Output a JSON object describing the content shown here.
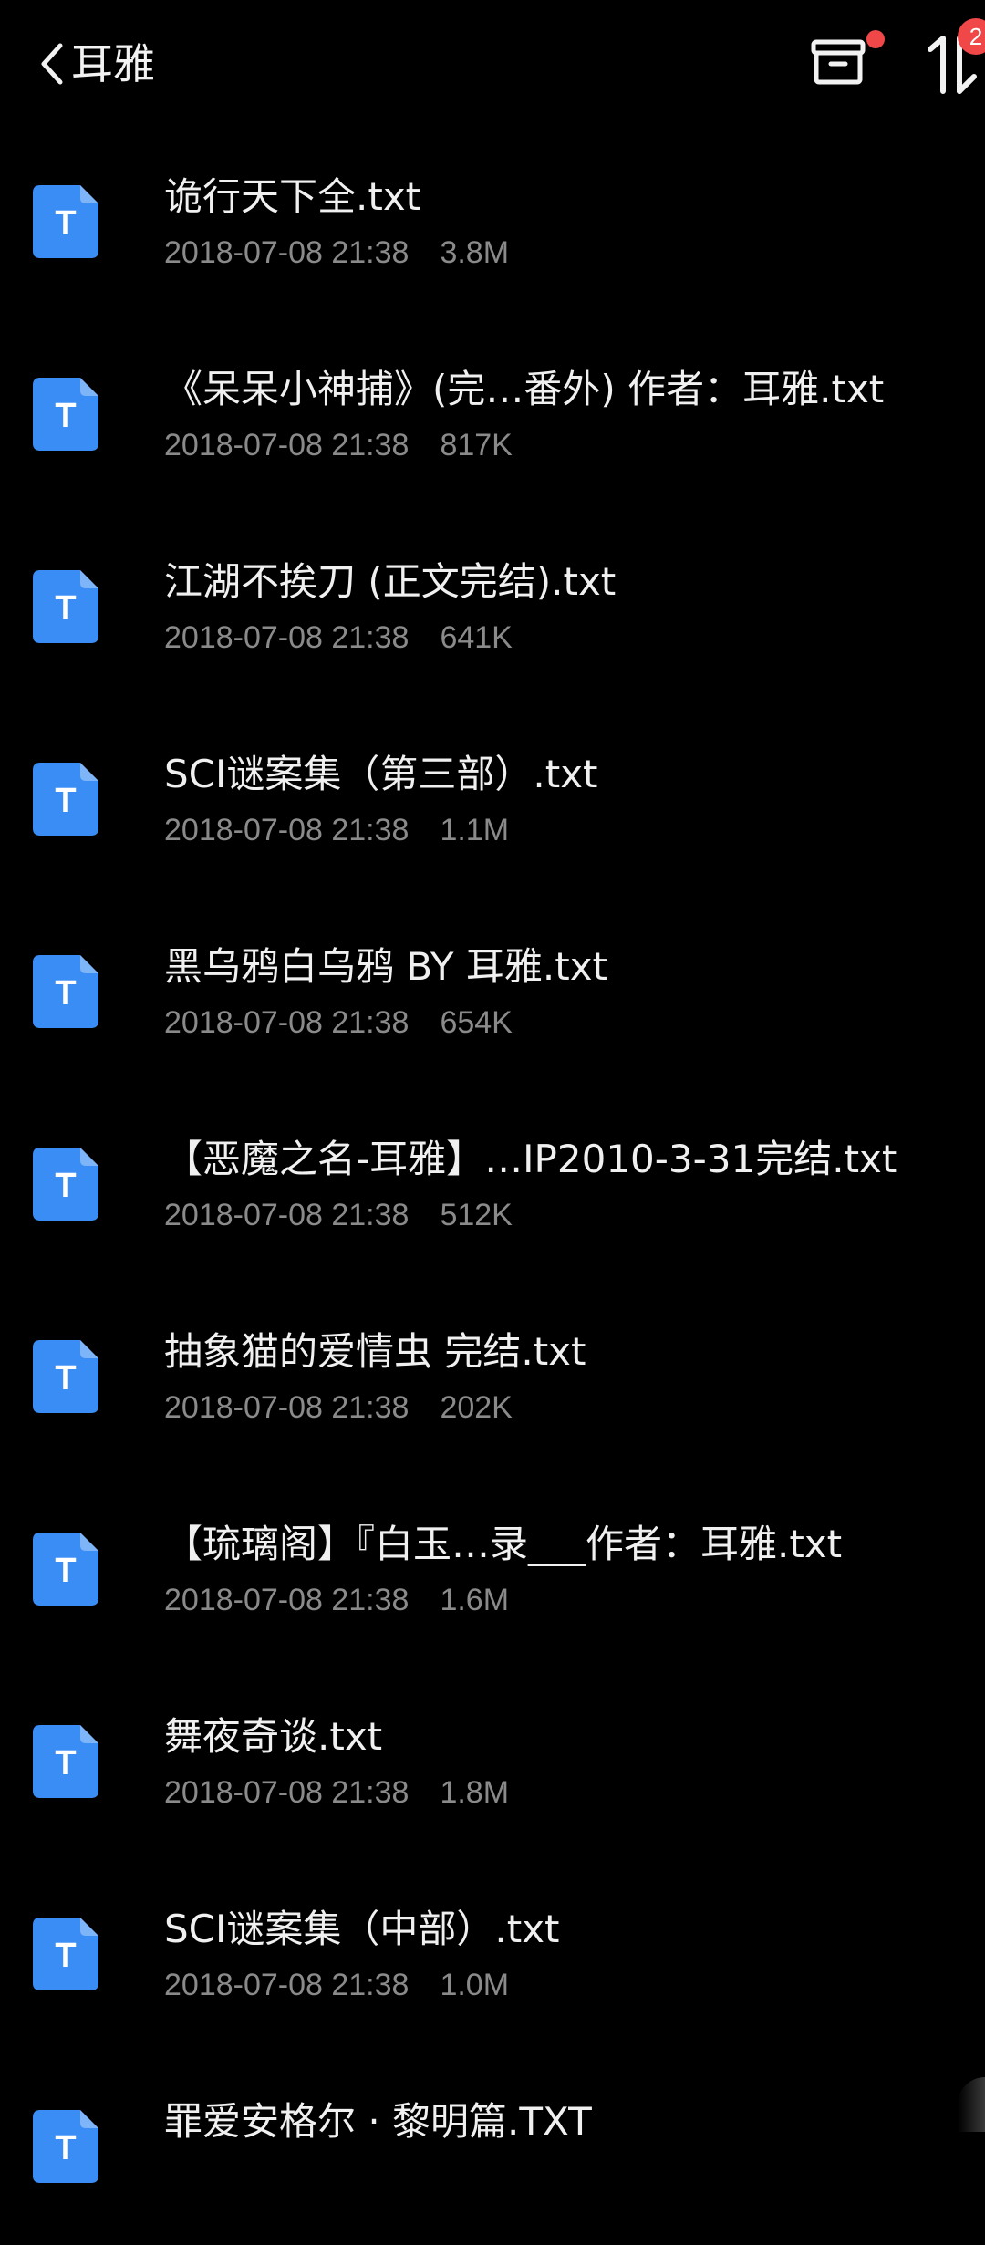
{
  "header": {
    "title": "耳雅",
    "back_icon": "chevron-left-icon",
    "archive_icon": "archive-box-icon",
    "sort_icon": "sort-icon",
    "badge_count": "2",
    "accent_red": "#f04848"
  },
  "icon_color": "#3a8df5",
  "icon_letter": "T",
  "files": [
    {
      "name": "诡行天下全.txt",
      "date": "2018-07-08 21:38",
      "size": "3.8M"
    },
    {
      "name": "《呆呆小神捕》(完…番外) 作者：耳雅.txt",
      "date": "2018-07-08 21:38",
      "size": "817K"
    },
    {
      "name": "江湖不挨刀 (正文完结).txt",
      "date": "2018-07-08 21:38",
      "size": "641K"
    },
    {
      "name": "SCI谜案集（第三部）.txt",
      "date": "2018-07-08 21:38",
      "size": "1.1M"
    },
    {
      "name": "黑乌鸦白乌鸦 BY 耳雅.txt",
      "date": "2018-07-08 21:38",
      "size": "654K"
    },
    {
      "name": "【恶魔之名-耳雅】…IP2010-3-31完结.txt",
      "date": "2018-07-08 21:38",
      "size": "512K"
    },
    {
      "name": "抽象猫的爱情虫 完结.txt",
      "date": "2018-07-08 21:38",
      "size": "202K"
    },
    {
      "name": "【琉璃阁】『白玉…录___作者：耳雅.txt",
      "date": "2018-07-08 21:38",
      "size": "1.6M"
    },
    {
      "name": "舞夜奇谈.txt",
      "date": "2018-07-08 21:38",
      "size": "1.8M"
    },
    {
      "name": "SCI谜案集（中部）.txt",
      "date": "2018-07-08 21:38",
      "size": "1.0M"
    },
    {
      "name": "罪爱安格尔 · 黎明篇.TXT",
      "date": "",
      "size": ""
    }
  ]
}
